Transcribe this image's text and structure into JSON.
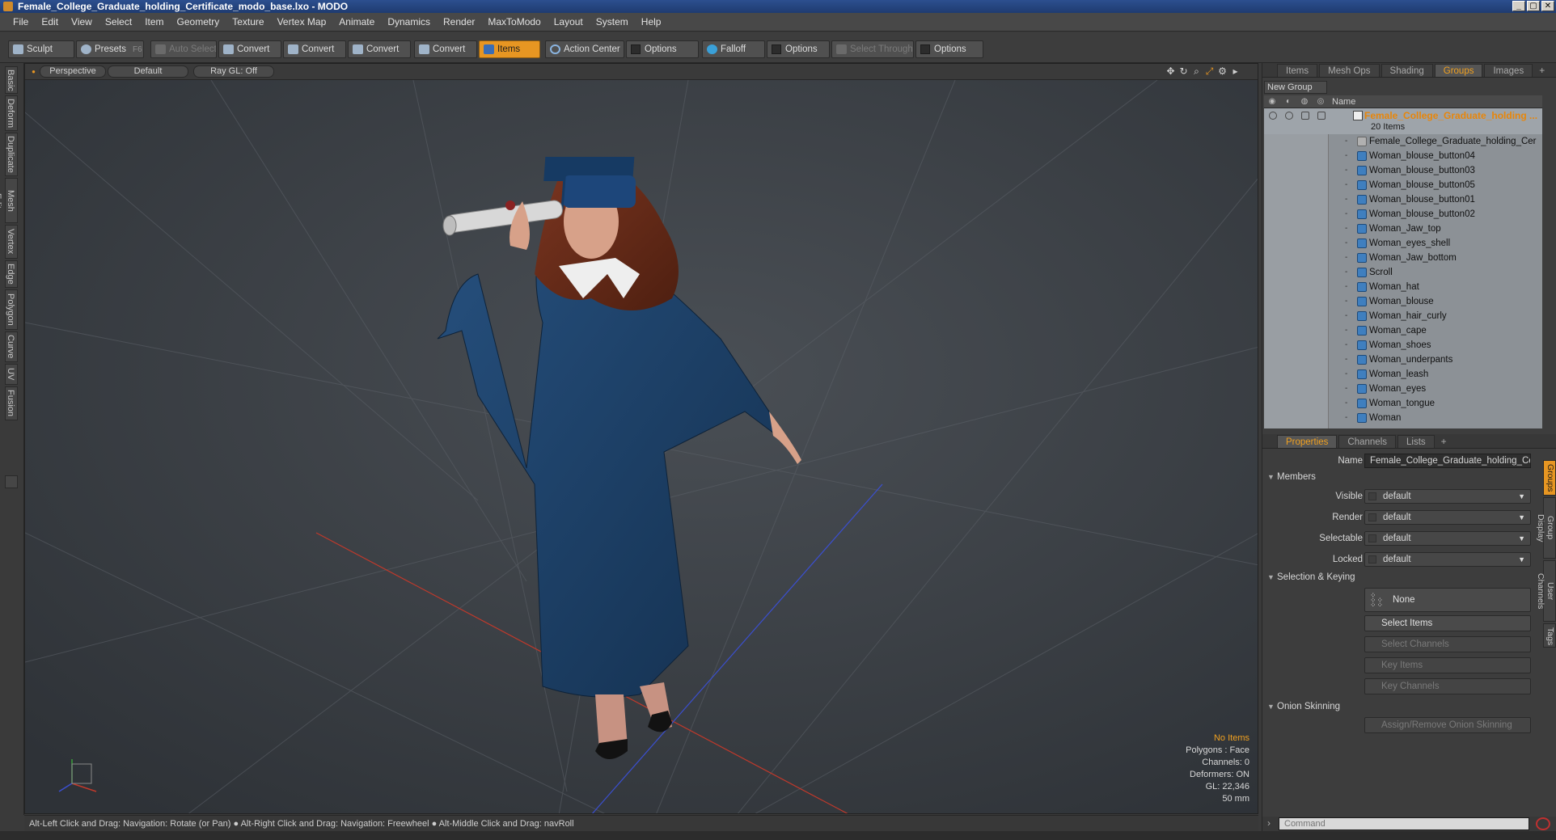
{
  "window": {
    "title": "Female_College_Graduate_holding_Certificate_modo_base.lxo - MODO",
    "buttons": [
      "_",
      "▢",
      "✕"
    ]
  },
  "menu": [
    "File",
    "Edit",
    "View",
    "Select",
    "Item",
    "Geometry",
    "Texture",
    "Vertex Map",
    "Animate",
    "Dynamics",
    "Render",
    "MaxToModo",
    "Layout",
    "System",
    "Help"
  ],
  "toolbar": {
    "sculpt": "Sculpt",
    "presets": "Presets",
    "presets_shortcut": "F6",
    "auto_select": "Auto Select",
    "convert1": "Convert",
    "convert2": "Convert",
    "convert3": "Convert",
    "convert4": "Convert",
    "items": "Items",
    "action_center": "Action Center",
    "options1": "Options",
    "falloff": "Falloff",
    "options2": "Options",
    "select_through": "Select Through",
    "options3": "Options"
  },
  "left_tabs": [
    "Basic",
    "Deform",
    "Duplicate",
    "Mesh Edit",
    "Vertex",
    "Edge",
    "Polygon",
    "Curve",
    "UV",
    "Fusion"
  ],
  "viewport": {
    "view": "Perspective",
    "shading": "Default",
    "raygl": "Ray GL: Off",
    "stats": {
      "items": "No Items",
      "polygons": "Polygons : Face",
      "channels": "Channels: 0",
      "deformers": "Deformers: ON",
      "gl": "GL: 22,346",
      "focal": "50 mm"
    }
  },
  "status": "Alt-Left Click and Drag: Navigation: Rotate (or Pan) ● Alt-Right Click and Drag: Navigation: Freewheel ● Alt-Middle Click and Drag: navRoll",
  "top_tabs": [
    "Items",
    "Mesh Ops",
    "Shading",
    "Groups",
    "Images"
  ],
  "groups": {
    "new_group": "New Group",
    "col_name": "Name",
    "group_name": "Female_College_Graduate_holding ...",
    "group_count": "20 Items",
    "members": [
      "Female_College_Graduate_holding_Cer ...",
      "Woman_blouse_button04",
      "Woman_blouse_button03",
      "Woman_blouse_button05",
      "Woman_blouse_button01",
      "Woman_blouse_button02",
      "Woman_Jaw_top",
      "Woman_eyes_shell",
      "Woman_Jaw_bottom",
      "Scroll",
      "Woman_hat",
      "Woman_blouse",
      "Woman_hair_curly",
      "Woman_cape",
      "Woman_shoes",
      "Woman_underpants",
      "Woman_leash",
      "Woman_eyes",
      "Woman_tongue",
      "Woman"
    ]
  },
  "prop_tabs": [
    "Properties",
    "Channels",
    "Lists"
  ],
  "properties": {
    "name_label": "Name",
    "name_value": "Female_College_Graduate_holding_Certi",
    "members_section": "Members",
    "visible_label": "Visible",
    "visible_value": "default",
    "render_label": "Render",
    "render_value": "default",
    "selectable_label": "Selectable",
    "selectable_value": "default",
    "locked_label": "Locked",
    "locked_value": "default",
    "selkey_section": "Selection & Keying",
    "none_btn": "None",
    "select_items": "Select Items",
    "select_channels": "Select Channels",
    "key_items": "Key Items",
    "key_channels": "Key Channels",
    "onion_section": "Onion Skinning",
    "assign_onion": "Assign/Remove Onion Skinning"
  },
  "side_tabs": [
    "Groups",
    "Group Display",
    "User Channels",
    "Tags"
  ],
  "command_placeholder": "Command",
  "colors": {
    "accent": "#e79622",
    "gown": "#1c3a5e",
    "hair": "#6b2a18"
  }
}
